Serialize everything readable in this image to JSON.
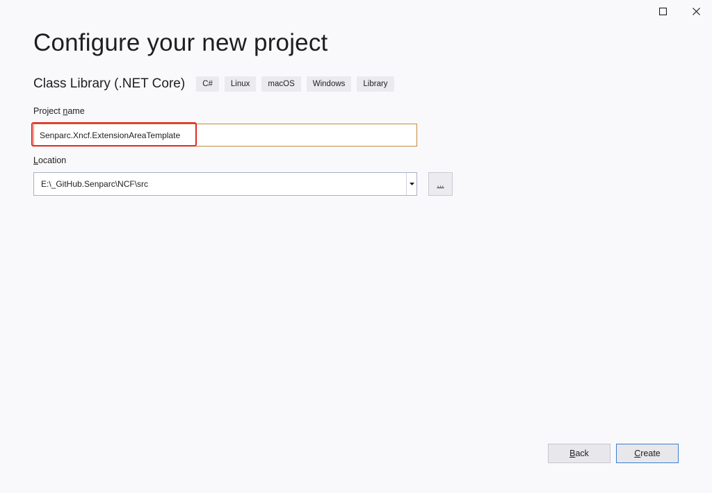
{
  "window_controls": {
    "maximize_icon": "maximize-icon",
    "close_icon": "close-icon"
  },
  "page_title": "Configure your new project",
  "template": {
    "name": "Class Library (.NET Core)",
    "tags": [
      "C#",
      "Linux",
      "macOS",
      "Windows",
      "Library"
    ]
  },
  "project_name": {
    "label_prefix": "Project ",
    "label_accel": "n",
    "label_suffix": "ame",
    "value": "Senparc.Xncf.ExtensionAreaTemplate"
  },
  "location": {
    "label_accel": "L",
    "label_suffix": "ocation",
    "value": "E:\\_GitHub.Senparc\\NCF\\src",
    "browse_label": "..."
  },
  "buttons": {
    "back_accel": "B",
    "back_suffix": "ack",
    "create_accel": "C",
    "create_suffix": "reate"
  },
  "colors": {
    "highlight_box": "#e0281e",
    "focus_border": "#c28a3c",
    "default_button_border": "#3a7fd0"
  }
}
